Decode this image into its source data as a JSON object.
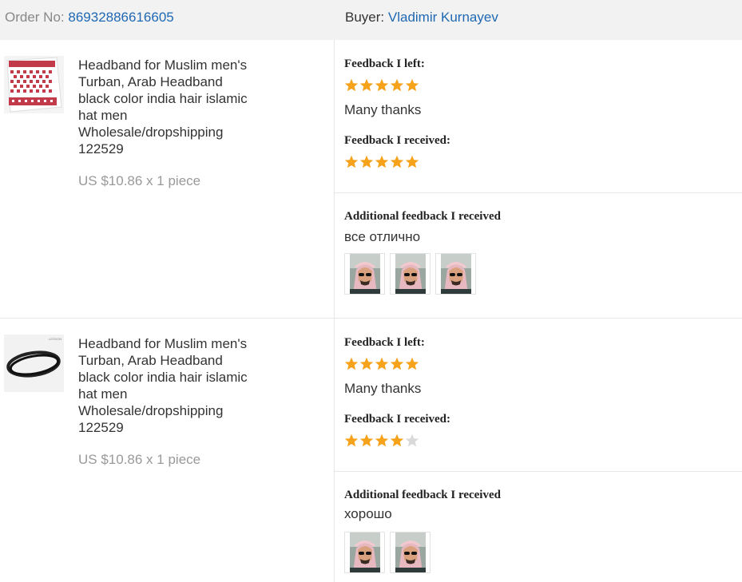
{
  "header": {
    "order_label": "Order No:",
    "order_number": "86932886616605",
    "buyer_label": "Buyer:",
    "buyer_name": "Vladimir Kurnayev"
  },
  "items": [
    {
      "title": "Headband for Muslim men's Turban, Arab Headband black color india hair islamic hat men Wholesale/dropshipping 122529",
      "price": "US $10.86 x 1 piece",
      "feedback_left_label": "Feedback I left:",
      "feedback_left_stars": 5,
      "feedback_left_text": "Many thanks",
      "feedback_received_label": "Feedback I received:",
      "feedback_received_stars": 5,
      "additional_label": "Additional feedback I received",
      "additional_text": "все отлично",
      "photo_count": 3
    },
    {
      "title": "Headband for Muslim men's Turban, Arab Headband black color india hair islamic hat men Wholesale/dropshipping 122529",
      "price": "US $10.86 x 1 piece",
      "feedback_left_label": "Feedback I left:",
      "feedback_left_stars": 5,
      "feedback_left_text": "Many thanks",
      "feedback_received_label": "Feedback I received:",
      "feedback_received_stars": 4,
      "additional_label": "Additional feedback I received",
      "additional_text": "хорошо",
      "photo_count": 2
    }
  ],
  "colors": {
    "star_filled": "#f7a21b",
    "star_empty": "#d9d9d9",
    "link": "#1f68b4"
  }
}
